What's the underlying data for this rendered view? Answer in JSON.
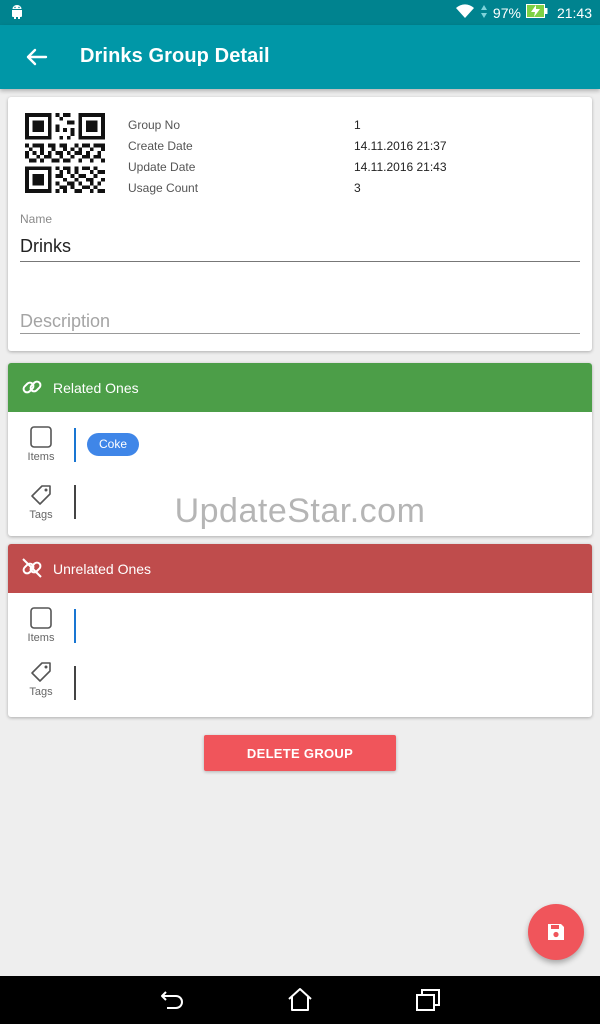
{
  "status_bar": {
    "battery_percent": "97%",
    "time": "21:43",
    "icons": [
      "android-icon",
      "wifi-icon",
      "signal-icon",
      "battery-charging-icon"
    ]
  },
  "app_bar": {
    "title": "Drinks Group Detail",
    "back_icon": "arrow-back-icon"
  },
  "details": {
    "qr_icon": "qr-code-icon",
    "labels": {
      "group_no": "Group No",
      "create_date": "Create Date",
      "update_date": "Update Date",
      "usage_count": "Usage Count"
    },
    "values": {
      "group_no": "1",
      "create_date": "14.11.2016 21:37",
      "update_date": "14.11.2016 21:43",
      "usage_count": "3"
    },
    "name_label": "Name",
    "name_value": "Drinks",
    "description_placeholder": "Description",
    "description_value": ""
  },
  "related": {
    "title": "Related Ones",
    "icon": "link-icon",
    "color": "#4c9e48",
    "items_label": "Items",
    "tags_label": "Tags",
    "items": [
      "Coke"
    ]
  },
  "unrelated": {
    "title": "Unrelated Ones",
    "icon": "link-off-icon",
    "color": "#bf4c4c",
    "items_label": "Items",
    "tags_label": "Tags"
  },
  "watermark": "UpdateStar.com",
  "actions": {
    "delete_label": "DELETE GROUP",
    "save_icon": "save-icon",
    "accent_color": "#f0555b"
  },
  "nav_bar": {
    "icons": [
      "back-nav-icon",
      "home-icon",
      "recents-icon"
    ]
  }
}
